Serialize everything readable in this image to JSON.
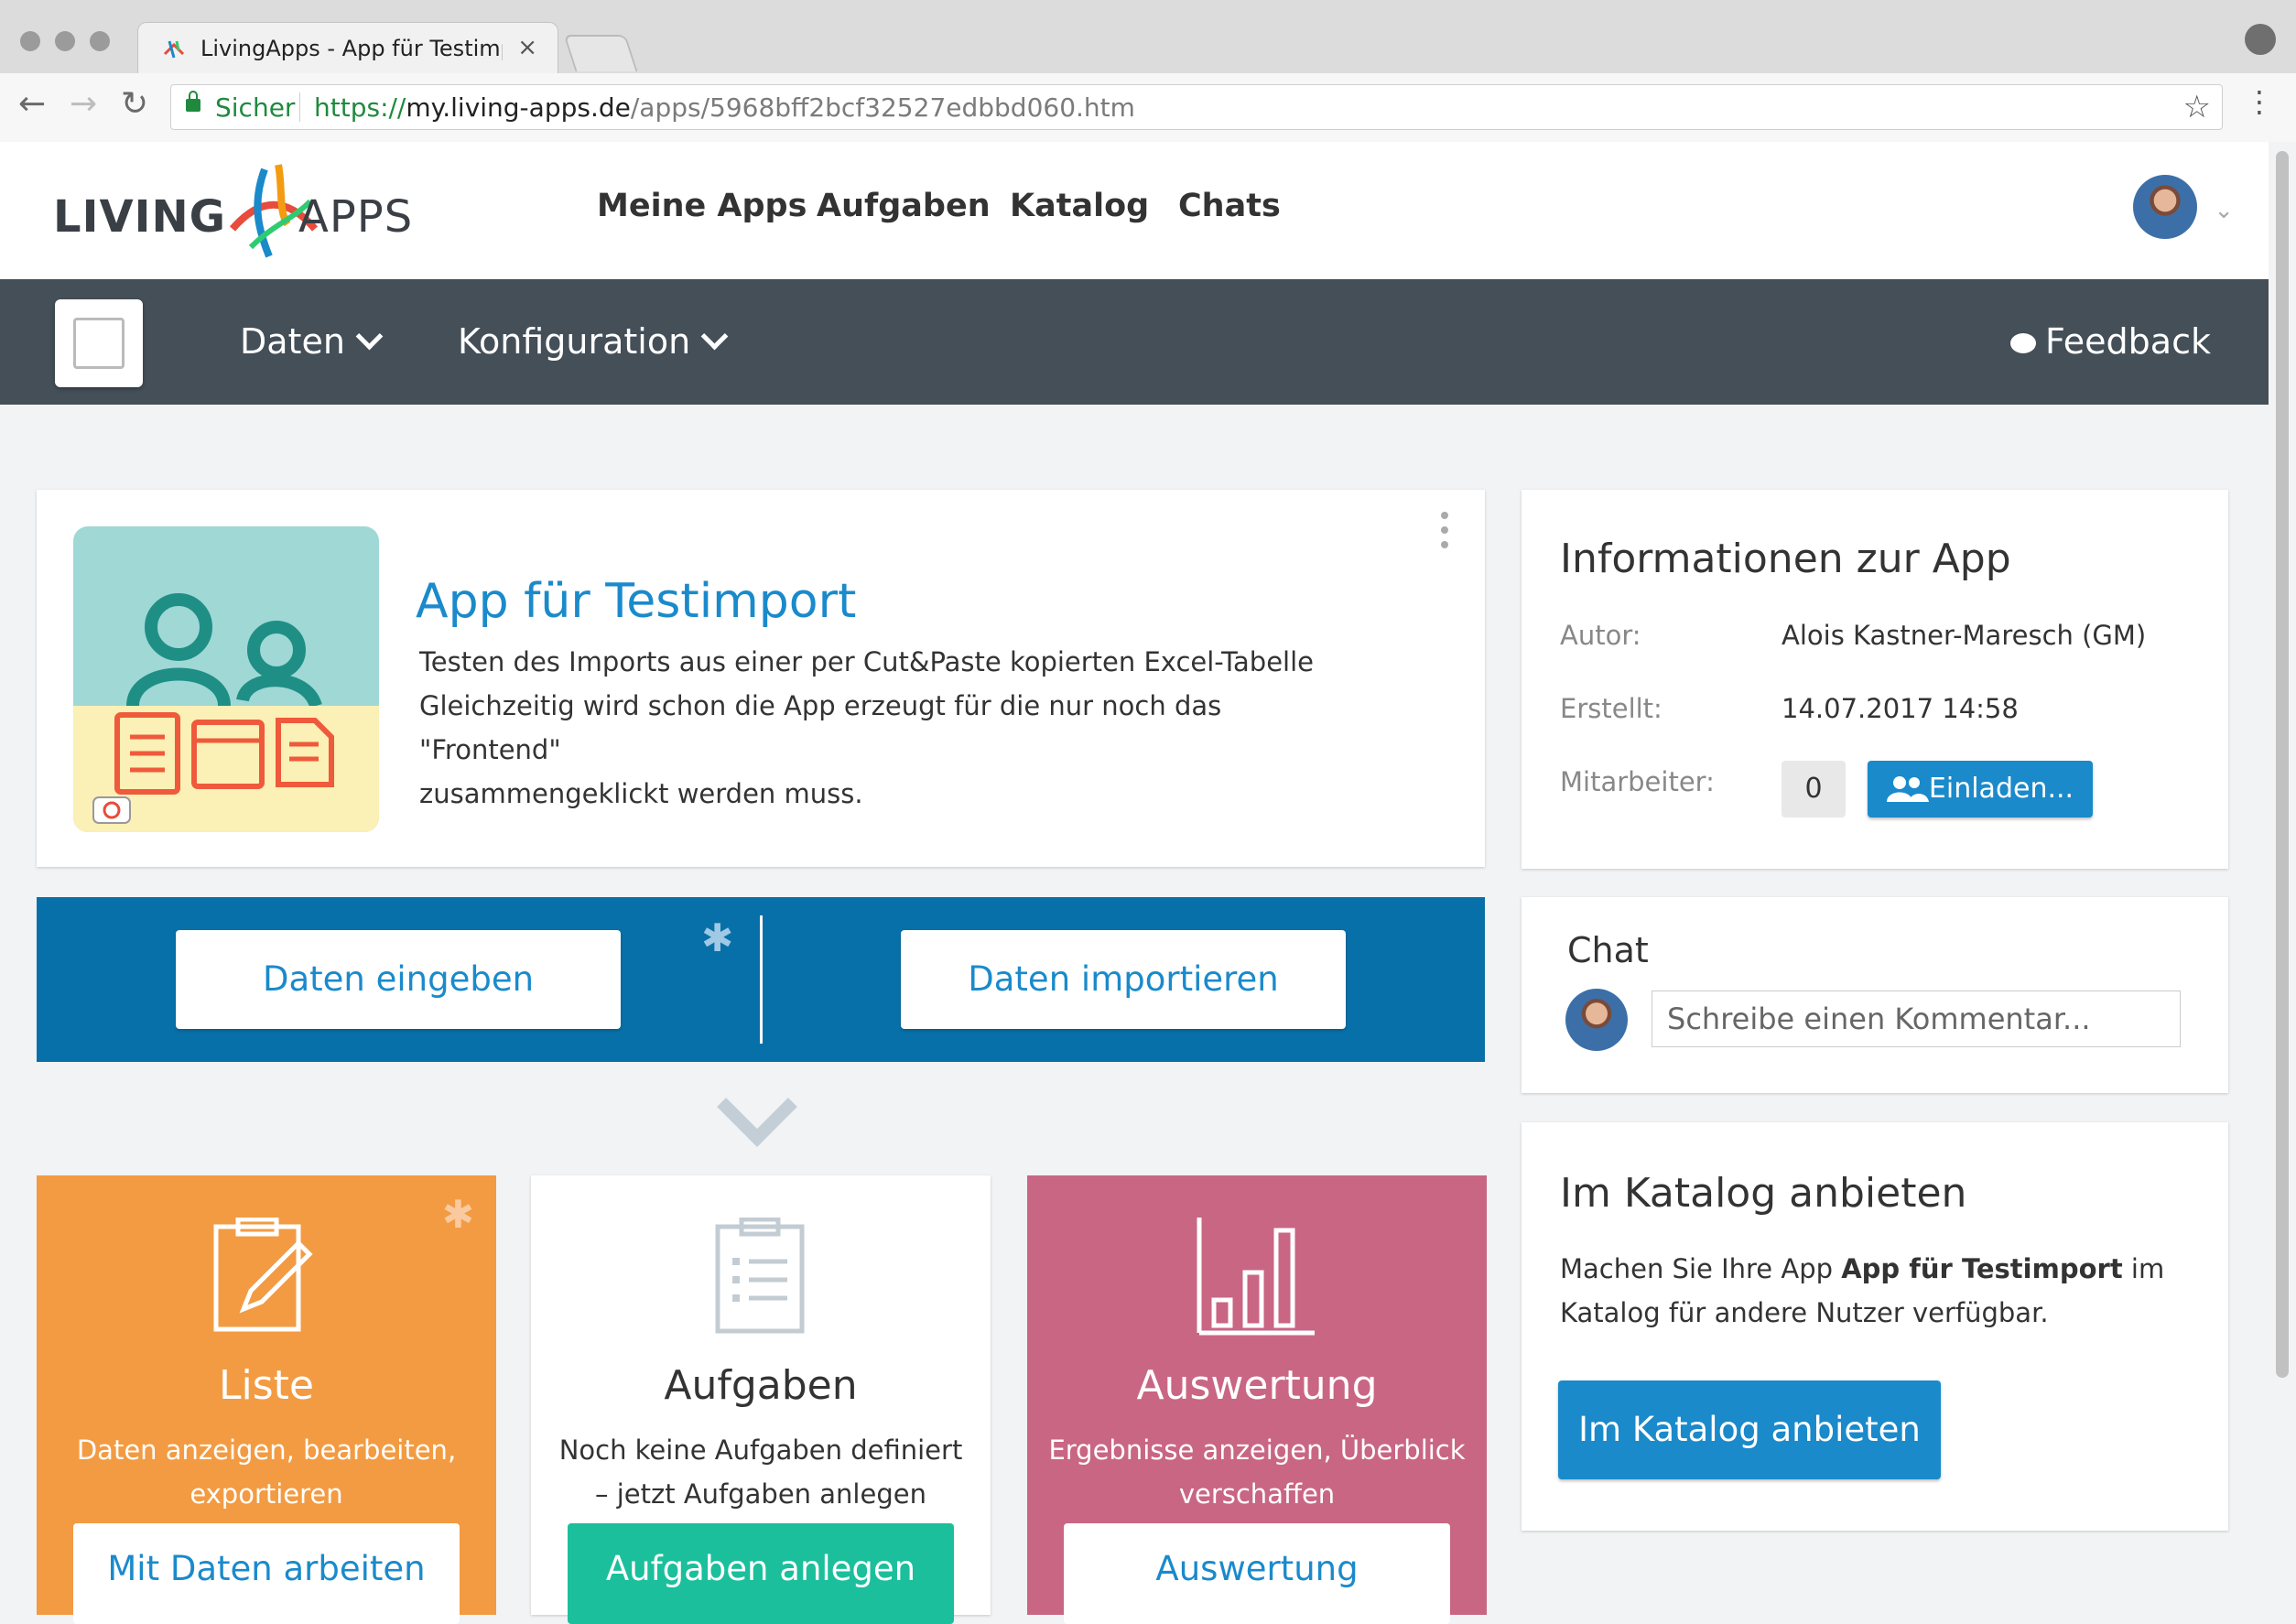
{
  "browser": {
    "tab_title": "LivingApps - App für Testimport",
    "tab_close": "×",
    "secure_label": "Sicher",
    "url_scheme": "https://",
    "url_host": "my.living-apps.de",
    "url_path": "/apps/5968bff2bcf32527edbbd060.htm",
    "back": "←",
    "forward": "→",
    "reload": "↻",
    "star": "☆",
    "menu": "⋮"
  },
  "header": {
    "logo_left": "LIVING",
    "logo_right": "APPS",
    "nav": [
      "Meine Apps",
      "Aufgaben",
      "Katalog",
      "Chats"
    ]
  },
  "subnav": {
    "daten": "Daten",
    "konfiguration": "Konfiguration",
    "feedback": "Feedback"
  },
  "app": {
    "title": "App für Testimport",
    "description_lines": [
      "Testen des Imports aus einer per Cut&Paste kopierten Excel-Tabelle",
      "Gleichzeitig wird schon die App erzeugt für die nur noch das \"Frontend\"",
      "zusammengeklickt werden muss."
    ]
  },
  "actions": {
    "enter": "Daten eingeben",
    "import": "Daten importieren",
    "gear": "✱"
  },
  "tiles": {
    "liste": {
      "title": "Liste",
      "desc": "Daten anzeigen, bearbeiten, exportieren",
      "button": "Mit Daten arbeiten"
    },
    "aufgaben": {
      "title": "Aufgaben",
      "desc": "Noch keine Aufgaben definiert – jetzt Aufgaben anlegen",
      "button": "Aufgaben anlegen"
    },
    "auswertung": {
      "title": "Auswertung",
      "desc": "Ergebnisse anzeigen, Überblick verschaffen",
      "button": "Auswertung"
    }
  },
  "info": {
    "title": "Informationen zur App",
    "author_label": "Autor:",
    "author_value": "Alois Kastner-Maresch (GM)",
    "created_label": "Erstellt:",
    "created_value": "14.07.2017 14:58",
    "collab_label": "Mitarbeiter:",
    "collab_count": "0",
    "invite": "Einladen..."
  },
  "chat": {
    "title": "Chat",
    "placeholder": "Schreibe einen Kommentar..."
  },
  "catalog": {
    "title": "Im Katalog anbieten",
    "desc_before": "Machen Sie Ihre App ",
    "desc_app": "App für Testimport",
    "desc_after": " im Katalog für andere Nutzer verfügbar.",
    "button": "Im Katalog anbieten"
  },
  "colors": {
    "accent": "#1a8acb",
    "subnav": "#444f58",
    "action_bar": "#0870a8",
    "tile_liste": "#f39b42",
    "tile_auswertung": "#c96683",
    "tile_aufgaben_btn": "#1bbf9b"
  }
}
